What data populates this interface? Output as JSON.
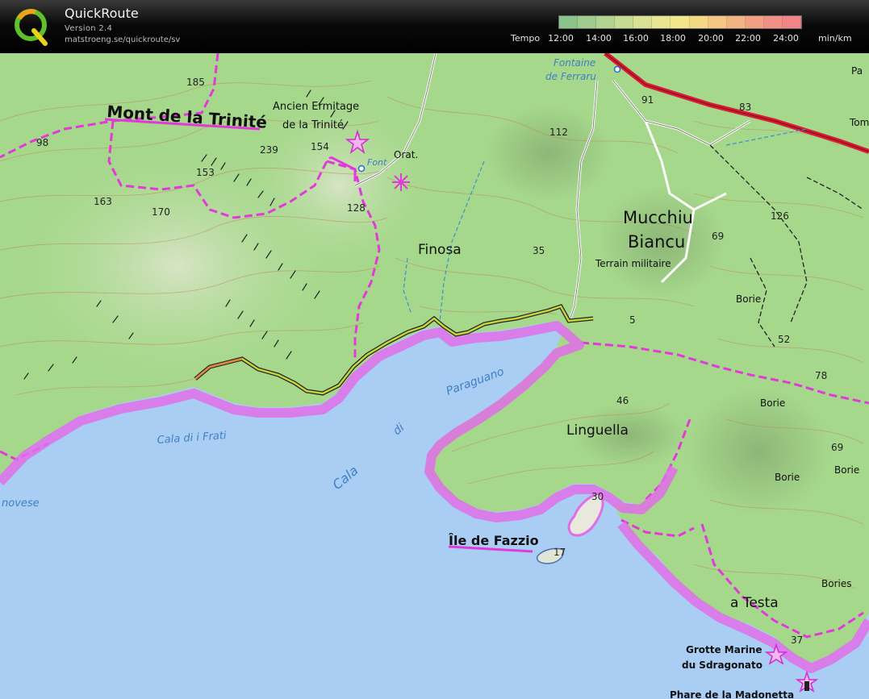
{
  "header": {
    "app_title": "QuickRoute",
    "version": "Version 2.4",
    "url": "matstroeng.se/quickroute/sv",
    "logo_letter": "Q"
  },
  "legend": {
    "label": "Tempo",
    "ticks": [
      "12:00",
      "14:00",
      "16:00",
      "18:00",
      "20:00",
      "22:00",
      "24:00"
    ],
    "unit": "min/km",
    "colors": [
      "#8bc48b",
      "#9fcc8e",
      "#b3d491",
      "#c6dc93",
      "#d9e294",
      "#e8e691",
      "#f2e58a",
      "#f4d985",
      "#f4c583",
      "#f3b282",
      "#f29f82",
      "#f28f86",
      "#f08486"
    ]
  },
  "map": {
    "colors": {
      "sea": "#a9cdf3",
      "land": "#a6d88c",
      "trail": "#e23ad8",
      "road": "#d81a34",
      "contour": "#c47b54"
    },
    "labels": {
      "mont": "Mont de la Trinité",
      "ermitage1": "Ancien Ermitage",
      "ermitage2": "de la Trinité",
      "finosa": "Finosa",
      "mucchiu": "Mucchiu",
      "biancu": "Biancu",
      "terrain": "Terrain militaire",
      "fontaine1": "Fontaine",
      "fontaine2": "de Ferraru",
      "paraguano": "Paraguano",
      "cala_di": "di",
      "cala": "Cala",
      "cala_frati": "Cala di i Frati",
      "linguella": "Linguella",
      "ile": "Île de Fazzio",
      "atesta": "a Testa",
      "grotte1": "Grotte Marine",
      "grotte2": "du Sdragonato",
      "phare": "Phare de la Madonetta",
      "genovese": "novese",
      "orat": "Orat.",
      "font": "Font",
      "borie1": "Borie",
      "borie2": "Borie",
      "borie3": "Borie",
      "borie4": "Borie",
      "bories": "Bories",
      "pa": "Pa",
      "tom": "Tom"
    },
    "spot_heights": {
      "h185": "185",
      "h98": "98",
      "h239": "239",
      "h154": "154",
      "h153": "153",
      "h163": "163",
      "h170": "170",
      "h128": "128",
      "h35": "35",
      "h112": "112",
      "h91": "91",
      "h83": "83",
      "h126": "126",
      "h69a": "69",
      "h5": "5",
      "h52": "52",
      "h78": "78",
      "h46": "46",
      "h69b": "69",
      "h30": "30",
      "h17": "17",
      "h37": "37"
    }
  }
}
